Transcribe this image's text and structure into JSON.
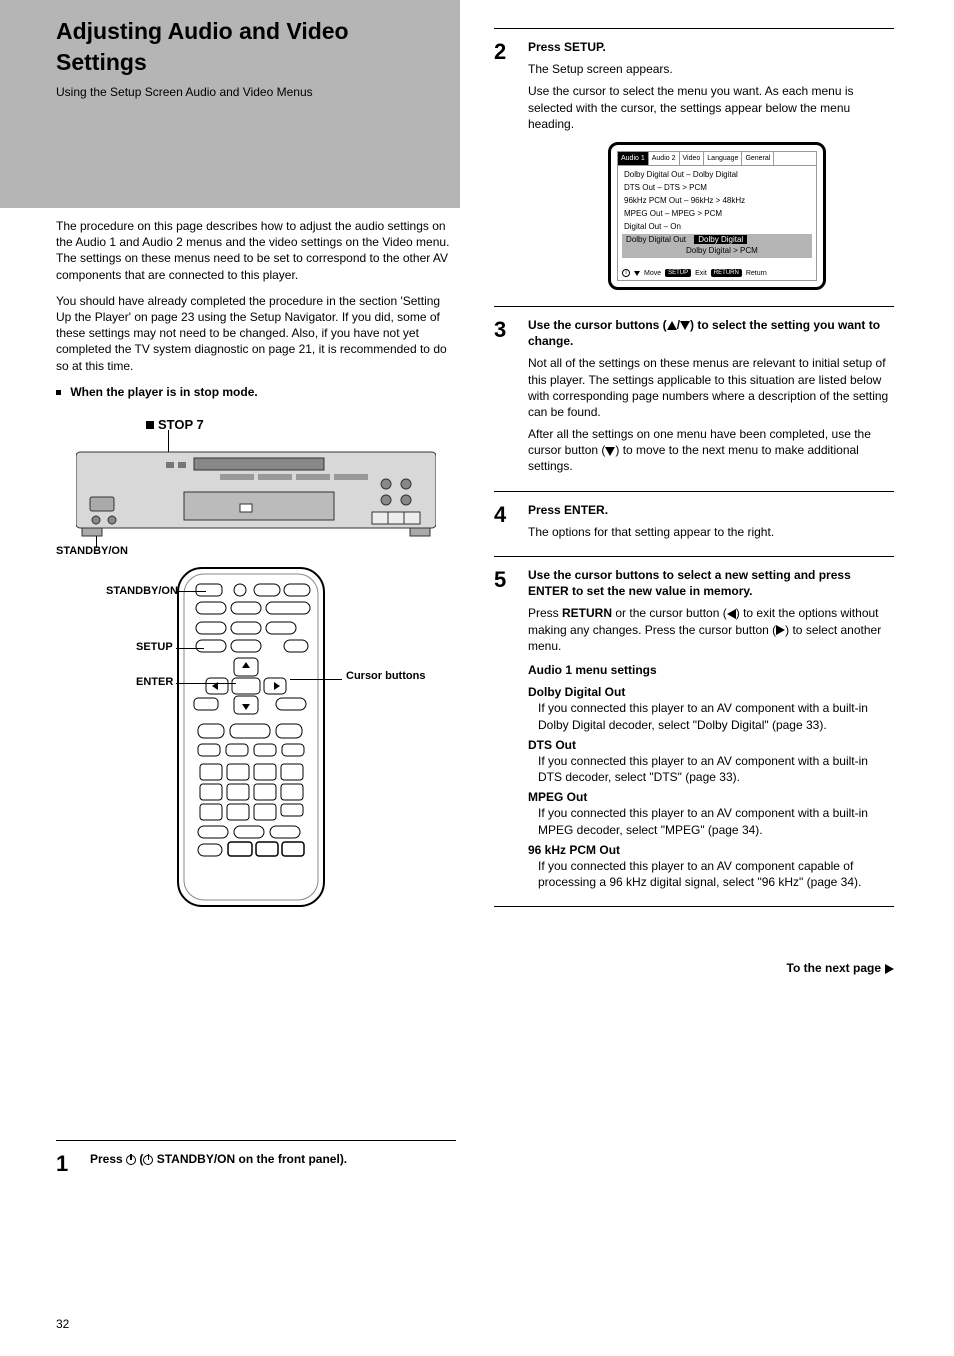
{
  "header": {
    "title": "Adjusting Audio and Video Settings",
    "subtitle": "Using the Setup Screen Audio and Video Menus"
  },
  "intro": {
    "p1": "The procedure on this page describes how to adjust the audio settings on the Audio 1 and Audio 2 menus and the video settings on the Video menu. The settings on these menus need to be set to correspond to the other AV components that are connected to this player.",
    "p2": "You should have already completed the procedure in the section 'Setting Up the Player' on page 23 using the Setup Navigator. If you did, some of these settings may not need to be changed. Also, if you have not yet completed the TV system diagnostic on page 21, it is recommended to do so at this time."
  },
  "controls": {
    "stop": "STOP 7",
    "standby_on": "STANDBY/ON",
    "remote_standby": "STANDBY/ON",
    "setup": "SETUP",
    "enter": "ENTER",
    "cursor": "Cursor buttons"
  },
  "steps": {
    "s1_num": "1",
    "s1_strong": "Press    (   STANDBY/ON on the front panel).",
    "s2_num": "2",
    "s2": {
      "bold": "Press SETUP.",
      "text": "The Setup screen appears.",
      "note": "Use the cursor to select the menu you want. As each menu is selected with the cursor, the settings appear below the menu heading."
    },
    "s3_num": "3",
    "s3": {
      "lead": "Use the cursor buttons (",
      "tail": ") to select the setting you want to change.",
      "p2": "Not all of the settings on these menus are relevant to initial setup of this player. The settings applicable to this situation are listed below with corresponding page numbers where a description of the setting can be found.",
      "p3": "After all the settings on one menu have been completed, use the cursor button (   ) to move to the next menu to make additional settings."
    },
    "s4_num": "4",
    "s4": {
      "bold": "Press ENTER.",
      "text": "The options for that setting appear to the right."
    },
    "s5_num": "5",
    "s5": {
      "lead": "Use the cursor buttons to select a new setting and press ENTER to set the new value in memory.",
      "p2": "Press RETURN or the cursor button (   ) to exit the options without making any changes. Press the cursor button (   ) to select another menu.",
      "audio1_title": "Audio 1 menu settings",
      "audio1": [
        {
          "label": "Dolby Digital Out",
          "desc": "If you connected this player to an AV component with a built-in Dolby Digital decoder, select \"Dolby Digital\" (page 33)."
        },
        {
          "label": "DTS Out",
          "desc": "If you connected this player to an AV component with a built-in DTS decoder, select \"DTS\" (page 33)."
        },
        {
          "label": "MPEG Out",
          "desc": "If you connected this player to an AV component with a built-in MPEG decoder, select \"MPEG\" (page 34)."
        },
        {
          "label": "96 kHz PCM Out",
          "desc": "If you connected this player to an AV component capable of processing a 96 kHz digital signal, select \"96 kHz\" (page 34)."
        }
      ]
    }
  },
  "screen": {
    "tabs": [
      "Audio 1",
      "Audio 2",
      "Video",
      "Language",
      "General"
    ],
    "active_tab": 0,
    "rows": [
      "Dolby Digital Out – Dolby Digital",
      "DTS Out – DTS > PCM",
      "96kHz PCM Out – 96kHz > 48kHz",
      "MPEG Out – MPEG > PCM",
      "Digital Out – On"
    ],
    "selector_label": "Dolby Digital Out",
    "selector_value": "Dolby Digital",
    "selector_alt": "Dolby Digital > PCM",
    "footer_move": "Move",
    "footer_setup": "SETUP",
    "footer_exit": "Exit",
    "footer_return": "RETURN",
    "footer_return2": "Return"
  },
  "to_next": "To the next page",
  "page_number": "32"
}
